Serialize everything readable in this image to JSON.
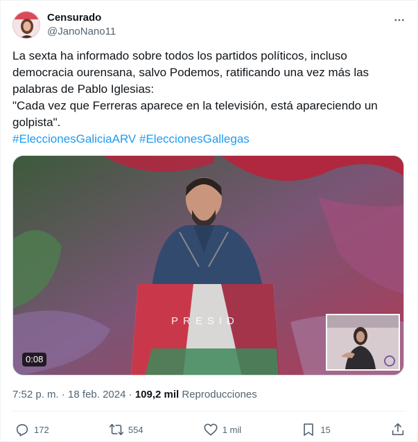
{
  "author": {
    "display_name": "Censurado",
    "handle": "@JanoNano11",
    "avatar_icon": "profile-photo-avatar"
  },
  "more_icon": "more-horizontal-icon",
  "tweet": {
    "line1": "La sexta ha informado sobre todos los partidos políticos, incluso democracia ourensana, salvo Podemos, ratificando una vez más las palabras de Pablo Iglesias:",
    "line2": "\"Cada vez que Ferreras aparece en la televisión, está apareciendo un golpista\".",
    "hashtag1": "#EleccionesGaliciaARV",
    "hashtag2": "#EleccionesGallegas"
  },
  "media": {
    "duration": "0:08",
    "podium_text": "PRESID"
  },
  "meta": {
    "time": "7:52 p. m.",
    "separator": "·",
    "date": "18 feb. 2024",
    "views_count": "109,2 mil",
    "views_label": "Reproducciones"
  },
  "actions": {
    "replies": "172",
    "reposts": "554",
    "likes": "1 mil",
    "bookmarks": "15"
  },
  "colors": {
    "link": "#1d9bf0",
    "secondary_text": "#536471",
    "primary_text": "#0f1419"
  }
}
